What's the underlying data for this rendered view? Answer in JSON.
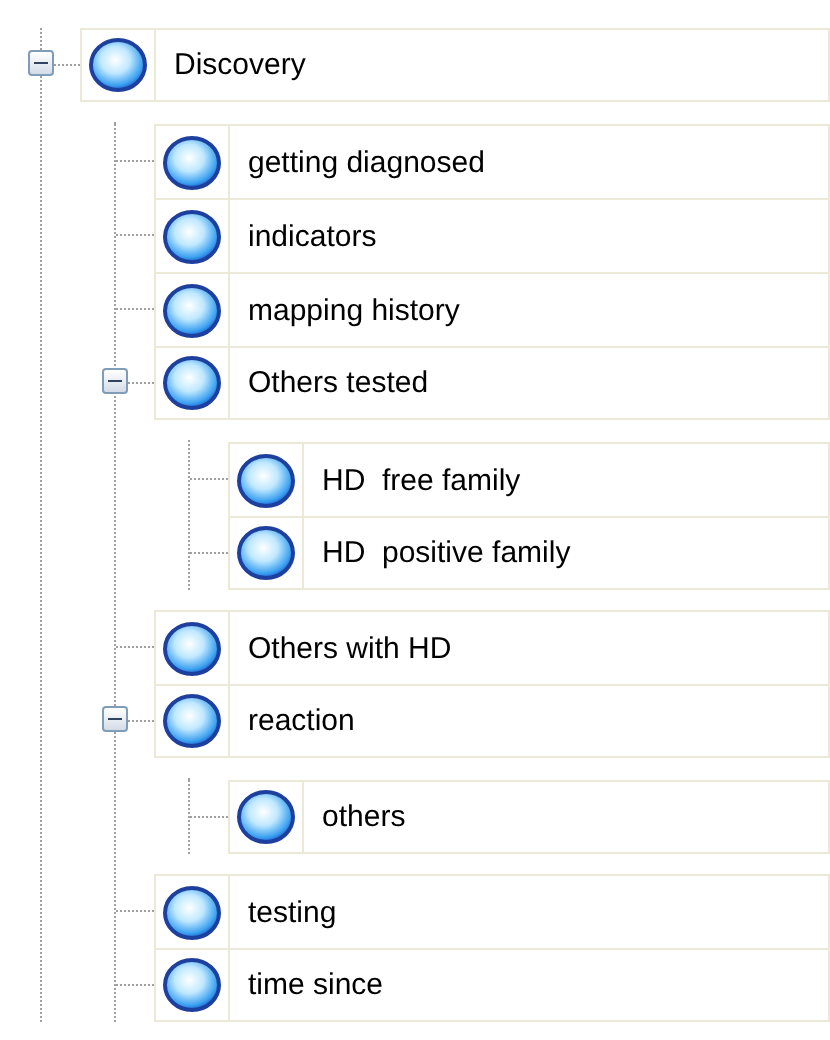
{
  "tree": [
    {
      "label": "Discovery",
      "expanded": true,
      "children": [
        {
          "label": "getting diagnosed"
        },
        {
          "label": "indicators"
        },
        {
          "label": "mapping history"
        },
        {
          "label": "Others tested",
          "expanded": true,
          "children": [
            {
              "label": "HD  free family"
            },
            {
              "label": "HD  positive family"
            }
          ]
        },
        {
          "label": "Others with HD"
        },
        {
          "label": "reaction",
          "expanded": true,
          "children": [
            {
              "label": "others"
            }
          ]
        },
        {
          "label": "testing"
        },
        {
          "label": "time since"
        }
      ]
    }
  ]
}
